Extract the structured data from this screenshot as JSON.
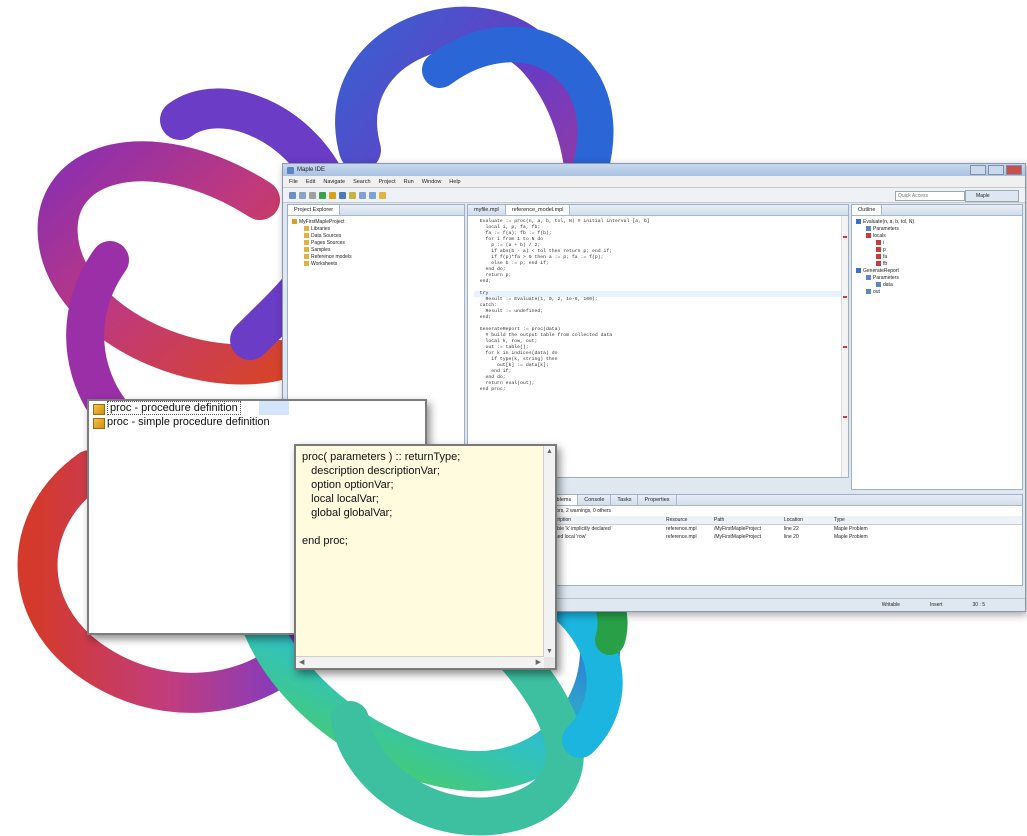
{
  "ide": {
    "title": "Maple IDE",
    "menus": [
      "File",
      "Edit",
      "Navigate",
      "Search",
      "Project",
      "Run",
      "Window",
      "Help"
    ],
    "search_placeholder": "Quick Access",
    "perspective": "Maple",
    "project_explorer": {
      "tab": "Project Explorer",
      "root": "MyFirstMapleProject",
      "items": [
        "Libraries",
        "Data Sources",
        "Pages Sources",
        "Samples",
        "Reference models",
        "Worksheets"
      ]
    },
    "editor_tabs": [
      "myfile.mpl",
      "reference_model.mpl"
    ],
    "code_lines": [
      "  Evaluate := proc(n, a, b, tol, N) # initial interval [a, b]",
      "    local i, p, fa, fb;",
      "    fa := f(a); fb := f(b);",
      "    for i from 1 to N do",
      "      p := (a + b) / 2;",
      "      if abs(b - a) < tol then return p; end if;",
      "      if f(p)*fa > 0 then a := p; fa := f(p);",
      "      else b := p; end if;",
      "    end do;",
      "    return p;",
      "  end;",
      "",
      "  try",
      "    Result := Evaluate(1, 0, 2, 1e-6, 100);",
      "  catch:",
      "    Result := undefined;",
      "  end;",
      "",
      "  GenerateReport := proc(data)",
      "    # build the output table from collected data",
      "    local k, row, out;",
      "    out := table();",
      "    for k in indices(data) do",
      "      if type(k, string) then",
      "        out[k] := data[k];",
      "      end if;",
      "    end do;",
      "    return eval(out);",
      "  end proc;"
    ],
    "outline": {
      "tab": "Outline",
      "items": [
        "Evaluate(n, a, b, tol, N)",
        "Parameters",
        "locals",
        "i",
        "p",
        "fa",
        "fb",
        "GenerateReport",
        "Parameters",
        "data",
        "out"
      ]
    },
    "problems": {
      "tabs": [
        "Problems",
        "Console",
        "Tasks",
        "Properties"
      ],
      "summary": "0 errors, 2 warnings, 0 others",
      "columns": [
        "Description",
        "Resource",
        "Path",
        "Location",
        "Type"
      ],
      "rows": [
        [
          "Variable 'k' implicitly declared",
          "reference.mpl",
          "/MyFirstMapleProject",
          "line 22",
          "Maple Problem"
        ],
        [
          "Unused local 'row'",
          "reference.mpl",
          "/MyFirstMapleProject",
          "line 20",
          "Maple Problem"
        ]
      ]
    },
    "status": [
      "Writable",
      "Insert",
      "30 : 5"
    ]
  },
  "assist": {
    "items": [
      {
        "label": "proc - procedure definition",
        "icon": "template-icon"
      },
      {
        "label": "proc - simple procedure definition",
        "icon": "template-icon"
      }
    ]
  },
  "preview": {
    "lines": [
      "proc( parameters ) :: returnType;",
      "   description descriptionVar;",
      "   option optionVar;",
      "   local localVar;",
      "   global globalVar;",
      "",
      "end proc;"
    ]
  },
  "colors": {
    "knot_gradient": [
      "#3566d4",
      "#8a2fb8",
      "#c23a7a",
      "#d63b2a",
      "#3bbd3f",
      "#25b8d6"
    ],
    "ide_chrome": "#dfe7f1",
    "preview_bg": "#fefbdf"
  }
}
